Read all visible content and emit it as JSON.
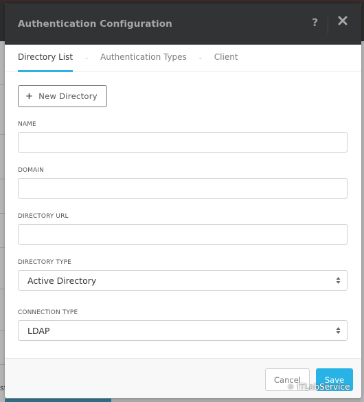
{
  "modal": {
    "title": "Authentication Configuration",
    "help_label": "?",
    "close_icon": "close-icon"
  },
  "tabs": [
    {
      "label": "Directory List",
      "active": true
    },
    {
      "label": "Authentication Types",
      "active": false
    },
    {
      "label": "Client",
      "active": false
    }
  ],
  "tab_separator": "-",
  "new_directory_button": {
    "icon": "plus-icon",
    "label": "New Directory"
  },
  "fields": {
    "name": {
      "label": "NAME",
      "value": "",
      "placeholder": ""
    },
    "domain": {
      "label": "DOMAIN",
      "value": "",
      "placeholder": ""
    },
    "directory_url": {
      "label": "DIRECTORY URL",
      "value": "",
      "placeholder": ""
    },
    "directory_type": {
      "label": "DIRECTORY TYPE",
      "selected": "Active Directory"
    },
    "connection_type": {
      "label": "CONNECTION TYPE",
      "selected": "LDAP"
    }
  },
  "footer": {
    "cancel_label": "Cancel",
    "save_label": "Save"
  },
  "watermark": {
    "icon": "wechat-icon",
    "text": "ITLabService"
  },
  "background": {
    "partial_text": "st"
  },
  "colors": {
    "header_bg": "#323334",
    "accent": "#2eb1df",
    "save_button": "#28b2e6"
  }
}
